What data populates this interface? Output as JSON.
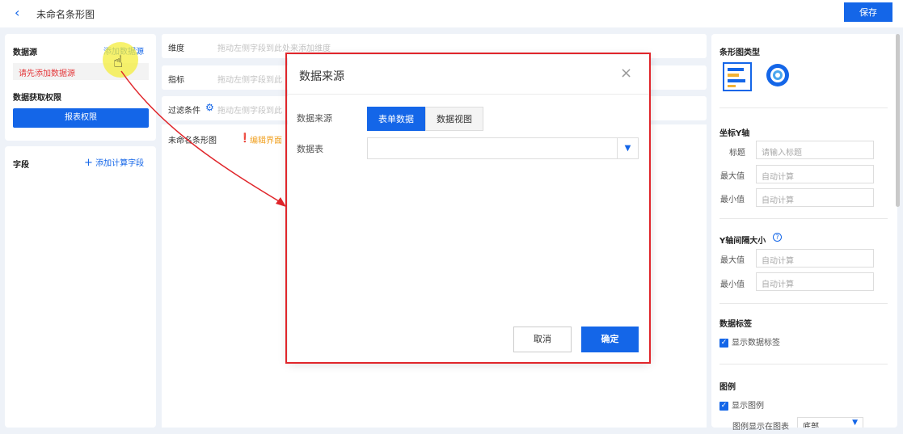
{
  "header": {
    "title": "未命名条形图",
    "save_label": "保存"
  },
  "left": {
    "datasource_label": "数据源",
    "add_datasource": "添加数据源",
    "warn_text": "请先添加数据源",
    "permission_label": "数据获取权限",
    "report_permission_btn": "报表权限",
    "fields_label": "字段",
    "add_calc_field": "添加计算字段"
  },
  "center": {
    "dimension_label": "维度",
    "dimension_ph": "拖动左侧字段到此处来添加维度",
    "metric_label": "指标",
    "metric_ph": "拖动左侧字段到此",
    "filter_label": "过滤条件",
    "filter_ph": "拖动左侧字段到此",
    "chart_name": "未命名条形图",
    "edit_hint": "编辑界面"
  },
  "right": {
    "chart_type_label": "条形图类型",
    "y_axis_label": "坐标Y轴",
    "title_k": "标题",
    "title_ph": "请输入标题",
    "max_k": "最大值",
    "max_ph": "自动计算",
    "min_k": "最小值",
    "min_ph": "自动计算",
    "y_interval_label": "Y轴间隔大小",
    "max2_k": "最大值",
    "max2_ph": "自动计算",
    "min2_k": "最小值",
    "min2_ph": "自动计算",
    "data_label_section": "数据标签",
    "show_data_label": "显示数据标签",
    "legend_section": "图例",
    "show_legend": "显示图例",
    "legend_pos_k": "图例显示在图表",
    "legend_pos_val": "底部"
  },
  "dialog": {
    "title": "数据来源",
    "source_k": "数据来源",
    "tab_form": "表单数据",
    "tab_view": "数据视图",
    "table_k": "数据表",
    "cancel": "取消",
    "confirm": "确定"
  },
  "colors": {
    "accent": "#1466e8",
    "warn": "#e4393c",
    "frame": "#e0262b"
  }
}
